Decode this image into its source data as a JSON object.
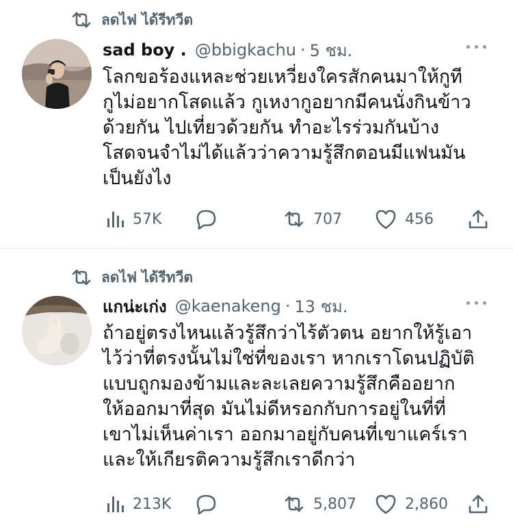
{
  "tweets": [
    {
      "retweeted_by": "ลดไฟ ได้รีทวีต",
      "name": "sad boy .",
      "handle": "@bbigkachu",
      "separator": "·",
      "time": "5 ชม.",
      "text": "โลกขอร้องแหละช่วยเหวี่ยงใครสักคนมาให้กูที\nกูไม่อยากโสดแล้ว กูเหงากูอยากมีคนนั่งกินข้าว\nด้วยกัน ไปเที่ยวด้วยกัน ทำอะไรร่วมกันบ้าง\nโสดจนจำไม่ได้แล้วว่าความรู้สึกตอนมีแฟนมัน\nเป็นยังไง",
      "views": "57K",
      "retweets": "707",
      "likes": "456"
    },
    {
      "retweeted_by": "ลดไฟ ได้รีทวีต",
      "name": "แกน่ะเก่ง",
      "handle": "@kaenakeng",
      "separator": "·",
      "time": "13 ชม.",
      "text": "ถ้าอยู่ตรงไหนแล้วรู้สึกว่าไร้ตัวตน อยากให้รู้เอา\nไว้ว่าที่ตรงนั้นไม่ใช่ที่ของเรา หากเราโดนปฏิบัติ\nแบบถูกมองข้ามและละเลยความรู้สึกคืออยาก\nให้ออกมาที่สุด มันไม่ดีหรอกกับการอยู่ในที่ที่\nเขาไม่เห็นค่าเรา ออกมาอยู่กับคนที่เขาแคร์เรา\nและให้เกียรติความรู้สึกเราดีกว่า",
      "views": "213K",
      "retweets": "5,807",
      "likes": "2,860"
    }
  ],
  "colors": {
    "text_primary": "#0f1419",
    "text_secondary": "#536471",
    "divider": "#eff3f4"
  },
  "icons": [
    "retweet-icon",
    "views-icon",
    "reply-icon",
    "like-icon",
    "share-icon",
    "more-icon"
  ]
}
